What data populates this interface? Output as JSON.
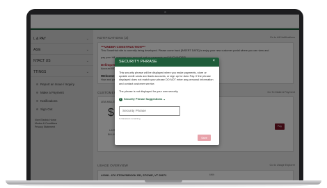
{
  "sidebar": {
    "items": [
      {
        "label": "L & PAY"
      },
      {
        "label": "AGE"
      },
      {
        "label": "NTACT US"
      },
      {
        "label": "TTINGS"
      }
    ],
    "sub_items": [
      {
        "label": "Report an Issue / Inquiry"
      },
      {
        "label": "Make a Payment"
      },
      {
        "label": "Notifications"
      },
      {
        "label": "Sign Out"
      }
    ],
    "footer_lines": [
      "Vore Electric Home",
      "Modes & Conditions",
      "Privacy Statement"
    ]
  },
  "notifications": {
    "heading": "NOTIFICATIONS (3)",
    "link": "Go to All Notifications",
    "alert_title": "***UNDER CONSTRUCTION***",
    "alert_text_1": "This SmartHub site is currently being developed. Please come back [INSERT DATE] to enjoy your new customer portal where you can view and",
    "alert_text_2": "pay your bill, manage your account, set up payments and MUCH MORE!",
    "delinquent_title": "Delinquent",
    "delinquent_text": "Account 6578",
    "welcome_title": "Welcome t",
    "welcome_text": "How and pay"
  },
  "customer": {
    "heading": "CUSTOMER BI",
    "link": "Go To Make A Payment",
    "name_fragment": "LEA MILLER",
    "amount_fragment": "$1",
    "label_fragment": "LAST",
    "label_fragment_2": "BILLING",
    "pay_label": "Pay"
  },
  "usage": {
    "heading": "USAGE OVERVIEW",
    "link": "Go to Usage Explorer",
    "address": "#2398 - 676 STONYBROOK RD, STOWE, VT 05672",
    "col_label": "kWh"
  },
  "modal": {
    "title": "SECURITY PHRASE",
    "close_glyph": "×",
    "text_1": "This security phrase will be displayed when you make payments, store or update credit cards and bank accounts, or sign up for Auto Pay. If the phrase displayed does not match your phrase DO NOT enter any personal information and contact customer service.",
    "text_2": "The phrase is not displayed for your own security.",
    "suggestions_label": "Security Phrase Suggestions",
    "suggestions_chevron": "⌄",
    "question_glyph": "?",
    "input_placeholder": "Security Phrase",
    "char_count": "0 characters remaining",
    "save_label": "Save"
  }
}
